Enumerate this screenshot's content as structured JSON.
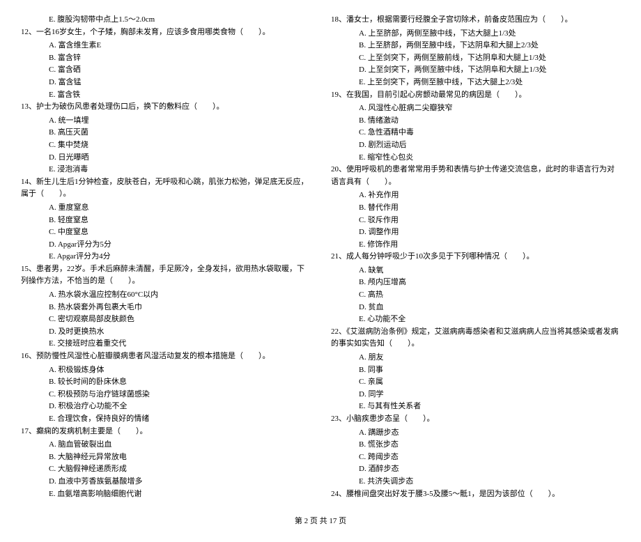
{
  "left": {
    "q11_e": "E. 腹股沟韧带中点上1.5～2.0cm",
    "q12": "12、一名16岁女生，个子矮，胸部未发育，应该多食用哪类食物（　　）。",
    "q12_a": "A. 富含维生素E",
    "q12_b": "B. 富含锌",
    "q12_c": "C. 富含硒",
    "q12_d": "D. 富含锰",
    "q12_e": "E. 富含铁",
    "q13": "13、护士为破伤风患者处理伤口后，换下的敷料应（　　）。",
    "q13_a": "A. 统一填埋",
    "q13_b": "B. 高压灭菌",
    "q13_c": "C. 集中焚烧",
    "q13_d": "D. 日光曝晒",
    "q13_e": "E. 浸泡消毒",
    "q14": "14、新生儿生后1分钟检查，皮肤苍白，无呼吸和心跳，肌张力松弛，弹足底无反应，属于（　　）。",
    "q14_a": "A. 重度窒息",
    "q14_b": "B. 轻度窒息",
    "q14_c": "C. 中度窒息",
    "q14_d": "D. Apgar评分为5分",
    "q14_e": "E. Apgar评分为4分",
    "q15": "15、患者男，22岁。手术后麻醉未清醒，手足厥冷，全身发抖，欲用热水袋取暖，下列操作方法，不恰当的是（　　）。",
    "q15_a": "A. 热水袋水温应控制在60°C以内",
    "q15_b": "B. 热水袋套外再包裹大毛巾",
    "q15_c": "C. 密切观察局部皮肤颜色",
    "q15_d": "D. 及时更换热水",
    "q15_e": "E. 交接班时应着重交代",
    "q16": "16、预防慢性风湿性心脏瓣膜病患者风湿活动复发的根本措施是（　　）。",
    "q16_a": "A. 积极锻炼身体",
    "q16_b": "B. 较长时间的卧床休息",
    "q16_c": "C. 积极预防与治疗链球菌感染",
    "q16_d": "D. 积极治疗心功能不全",
    "q16_e": "E. 合理饮食，保持良好的情绪",
    "q17": "17、癫痫的发病机制主要是（　　）。",
    "q17_a": "A. 脑血管破裂出血",
    "q17_b": "B. 大脑神经元异常放电",
    "q17_c": "C. 大脑假神经递质形成",
    "q17_d": "D. 血液中芳香族氨基酸增多",
    "q17_e": "E. 血氨增高影响脑细胞代谢"
  },
  "right": {
    "q18": "18、潘女士，根据需要行经腹全子宫切除术，前备皮范围应为（　　）。",
    "q18_a": "A. 上至脐部，两侧至腋中线，下达大腿上1/3处",
    "q18_b": "B. 上至脐部，两侧至腋中线，下达阴阜和大腿上2/3处",
    "q18_c": "C. 上至剑突下，两侧至腋前线，下达阴阜和大腿上1/3处",
    "q18_d": "D. 上至剑突下，两侧至腋中线，下达阴阜和大腿上1/3处",
    "q18_e": "E. 上至剑突下，两侧至腋中线，下达大腿上2/3处",
    "q19": "19、在我国，目前引起心房颤动最常见的病因是（　　）。",
    "q19_a": "A. 风湿性心脏病二尖瓣狭窄",
    "q19_b": "B. 情绪激动",
    "q19_c": "C. 急性酒精中毒",
    "q19_d": "D. 剧烈运动后",
    "q19_e": "E. 缩窄性心包炎",
    "q20": "20、使用呼吸机的患者常常用手势和表情与护士传递交流信息，此时的非语言行为对语言具有（　　）。",
    "q20_a": "A. 补充作用",
    "q20_b": "B. 替代作用",
    "q20_c": "C. 驳斥作用",
    "q20_d": "D. 调整作用",
    "q20_e": "E. 修饰作用",
    "q21": "21、成人每分钟呼吸少于10次多见于下列哪种情况（　　）。",
    "q21_a": "A. 缺氧",
    "q21_b": "B. 颅内压增高",
    "q21_c": "C. 高热",
    "q21_d": "D. 贫血",
    "q21_e": "E. 心功能不全",
    "q22": "22、《艾滋病防治条例》规定，艾滋病病毒感染者和艾滋病病人应当将其感染或者发病的事实如实告知（　　）。",
    "q22_a": "A. 朋友",
    "q22_b": "B. 同事",
    "q22_c": "C. 亲属",
    "q22_d": "D. 同学",
    "q22_e": "E. 与其有性关系者",
    "q23": "23、小脑疾患步态呈（　　）。",
    "q23_a": "A. 蹒跚步态",
    "q23_b": "B. 慌张步态",
    "q23_c": "C. 跨阈步态",
    "q23_d": "D. 酒醉步态",
    "q23_e": "E. 共济失调步态",
    "q24": "24、腰椎间盘突出好发于腰3-5及腰5～骶1，是因为该部位（　　）。"
  },
  "footer": "第 2 页 共 17 页"
}
